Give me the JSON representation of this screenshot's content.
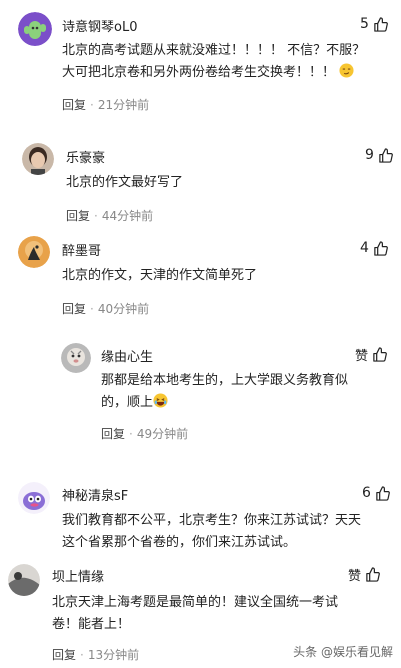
{
  "comments": [
    {
      "user": "诗意钢琴oL0",
      "likes": "5",
      "line1": "北京的高考试题从来就没难过！！！！ 不信？不服？",
      "line2": "大可把北京卷和另外两份卷给考生交换考！！！",
      "reply": "回复",
      "time": "21分钟前"
    },
    {
      "user": "乐豪豪",
      "likes": "9",
      "line1": "北京的作文最好写了",
      "reply": "回复",
      "time": "44分钟前"
    },
    {
      "user": "醉墨哥",
      "likes": "4",
      "line1": "北京的作文，天津的作文简单死了",
      "reply": "回复",
      "time": "40分钟前"
    },
    {
      "user": "缘由心生",
      "likes": "赞",
      "line1": "那都是给本地考生的，上大学跟义务教育似",
      "line2": "的，顺上",
      "reply": "回复",
      "time": "49分钟前"
    },
    {
      "user": "神秘清泉sF",
      "likes": "6",
      "line1": "我们教育都不公平，北京考生？你来江苏试试？天天",
      "line2": "这个省累那个省卷的，你们来江苏试试。",
      "reply": "回复",
      "time": ""
    },
    {
      "user": "坝上情缘",
      "likes": "赞",
      "line1": "北京天津上海考题是最简单的！建议全国统一考试",
      "line2": "卷！能者上！",
      "reply": "回复",
      "time": "13分钟前"
    }
  ],
  "watermark": "头条 @娱乐看见解",
  "colors": {
    "text": "#222222",
    "meta": "#888888",
    "accent_red": "#e33333"
  }
}
